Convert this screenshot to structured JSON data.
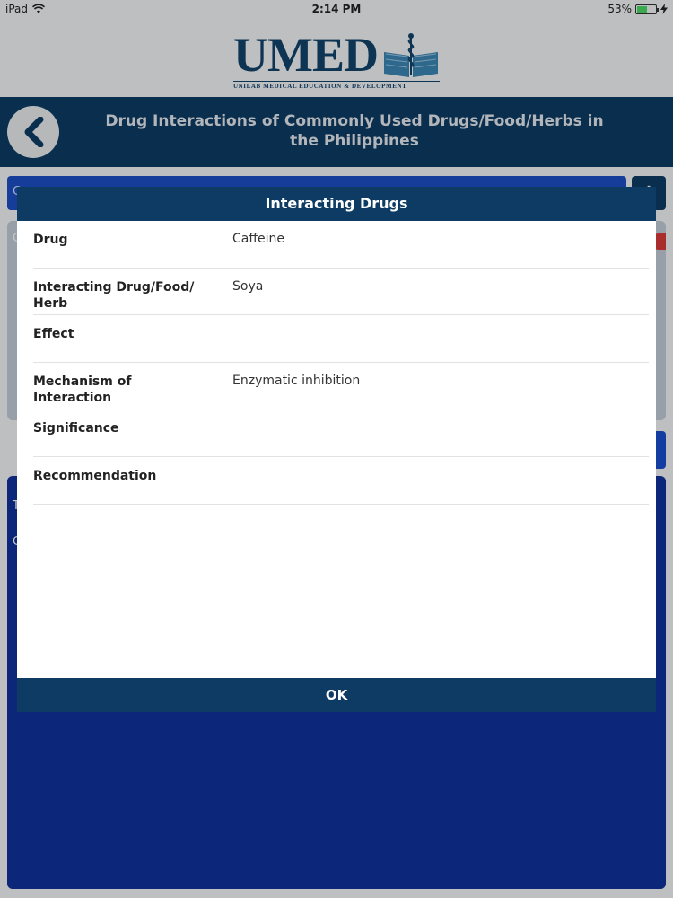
{
  "status_bar": {
    "device": "iPad",
    "time": "2:14 PM",
    "battery": "53%",
    "battery_level": 0.53,
    "icons": [
      "wifi-icon",
      "battery-icon",
      "charging-icon"
    ]
  },
  "logo": {
    "name": "UMED",
    "tagline": "UNILAB MEDICAL EDUCATION & DEVELOPMENT"
  },
  "header": {
    "title": "Drug Interactions of Commonly Used Drugs/Food/Herbs in the Philippines",
    "back_icon": "chevron-left-icon"
  },
  "background": {
    "search_field_text": "C",
    "add_button_label": "+",
    "panel1_text": "C",
    "panel2_lines": [
      "T",
      "C"
    ]
  },
  "modal": {
    "title": "Interacting Drugs",
    "rows": [
      {
        "label": "Drug",
        "value": "Caffeine"
      },
      {
        "label": "Interacting Drug/Food/ Herb",
        "value": "Soya"
      },
      {
        "label": "Effect",
        "value": ""
      },
      {
        "label": "Mechanism of Interaction",
        "value": "Enzymatic inhibition"
      },
      {
        "label": "Significance",
        "value": ""
      },
      {
        "label": "Recommendation",
        "value": ""
      }
    ],
    "ok_label": "OK"
  },
  "colors": {
    "header": "#0e3b63",
    "page_blue": "#10329b",
    "field_blue": "#1b4fc4",
    "battery_green": "#4cd964"
  }
}
